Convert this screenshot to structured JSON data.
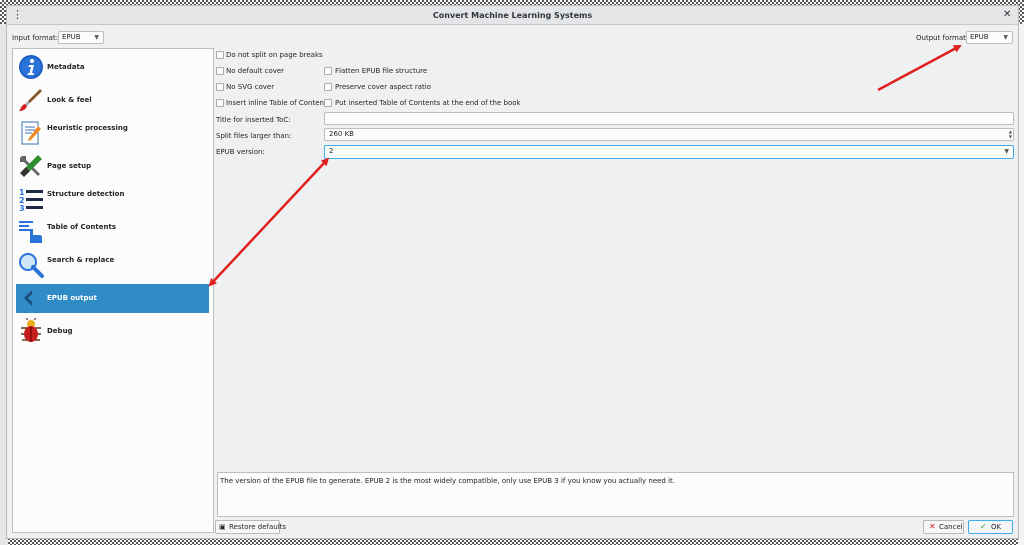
{
  "window": {
    "title": "Convert Machine Learning Systems",
    "menu_glyph": "⋮",
    "close_glyph": "✕"
  },
  "input_format": {
    "label": "Input format:",
    "value": "EPUB"
  },
  "output_format": {
    "label": "Output format:",
    "value": "EPUB"
  },
  "sidebar": {
    "items": [
      {
        "label": "Metadata",
        "icon": "info-icon"
      },
      {
        "label": "Look & feel",
        "icon": "paintbrush-icon"
      },
      {
        "label": "Heuristic processing",
        "icon": "document-pen-icon"
      },
      {
        "label": "Page setup",
        "icon": "tools-icon"
      },
      {
        "label": "Structure detection",
        "icon": "numbered-list-icon"
      },
      {
        "label": "Table of Contents",
        "icon": "toc-hand-icon"
      },
      {
        "label": "Search & replace",
        "icon": "magnifier-icon"
      },
      {
        "label": "EPUB output",
        "icon": "back-arrow-icon",
        "selected": true
      },
      {
        "label": "Debug",
        "icon": "bug-icon"
      }
    ]
  },
  "options": {
    "no_split": "Do not split on page breaks",
    "no_default_cover": "No default cover",
    "flatten": "Flatten EPUB file structure",
    "no_svg_cover": "No SVG cover",
    "preserve_aspect": "Preserve cover aspect ratio",
    "inline_toc": "Insert inline Table of Contents",
    "toc_end": "Put inserted Table of Contents at the end of the book",
    "toc_title_label": "Title for inserted ToC:",
    "toc_title_value": "",
    "split_label": "Split files larger than:",
    "split_value": "260 KB",
    "version_label": "EPUB version:",
    "version_value": "2"
  },
  "description": "The version of the EPUB file to generate. EPUB 2 is the most widely compatible, only use EPUB 3 if you know you actually need it.",
  "buttons": {
    "restore": "Restore defaults",
    "cancel": "Cancel",
    "ok": "OK"
  },
  "colors": {
    "selection": "#308cc6",
    "annotation_arrow": "#e0201c",
    "focus": "#3daee9"
  }
}
